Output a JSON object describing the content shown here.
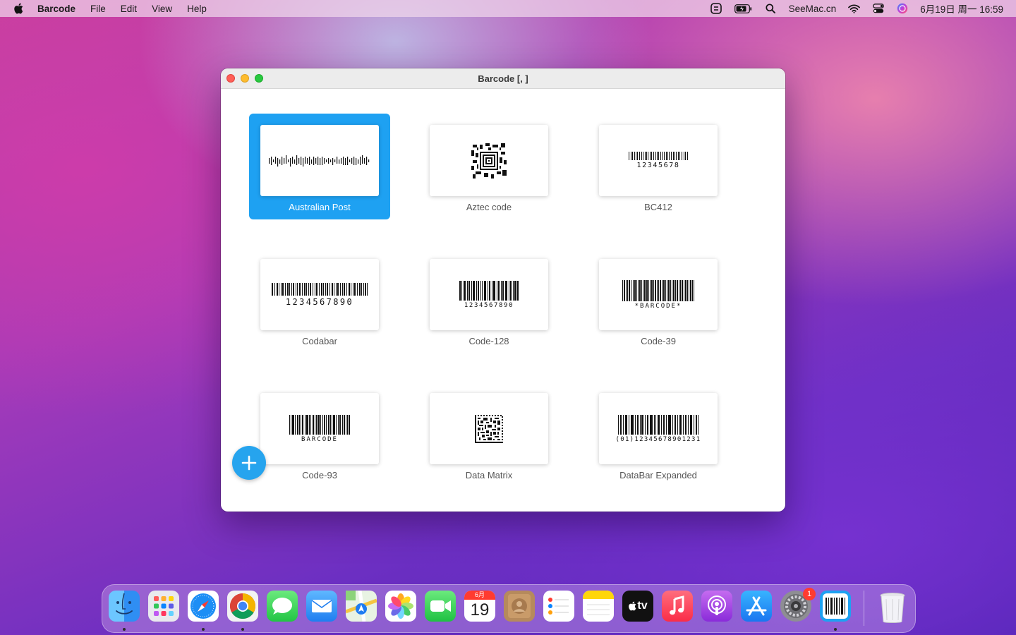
{
  "menubar": {
    "app_name": "Barcode",
    "menus": [
      "File",
      "Edit",
      "View",
      "Help"
    ],
    "status_text": "SeeMac.cn",
    "datetime": "6月19日 周一  16:59"
  },
  "window": {
    "title": "Barcode [, ]"
  },
  "barcodes": [
    {
      "label": "Australian Post",
      "sample": "",
      "selected": true
    },
    {
      "label": "Aztec code",
      "sample": ""
    },
    {
      "label": "BC412",
      "sample": "12345678"
    },
    {
      "label": "Codabar",
      "sample": "1234567890"
    },
    {
      "label": "Code-128",
      "sample": "1234567890"
    },
    {
      "label": "Code-39",
      "sample": "*BARCODE*"
    },
    {
      "label": "Code-93",
      "sample": "BARCODE"
    },
    {
      "label": "Data Matrix",
      "sample": ""
    },
    {
      "label": "DataBar Expanded",
      "sample": "(01)12345678901231"
    }
  ],
  "dock": {
    "calendar_month": "6月",
    "calendar_day": "19",
    "tv_label": "tv",
    "settings_badge": "1"
  },
  "colors": {
    "accent": "#1ea1f2",
    "fab": "#26a4ee"
  }
}
